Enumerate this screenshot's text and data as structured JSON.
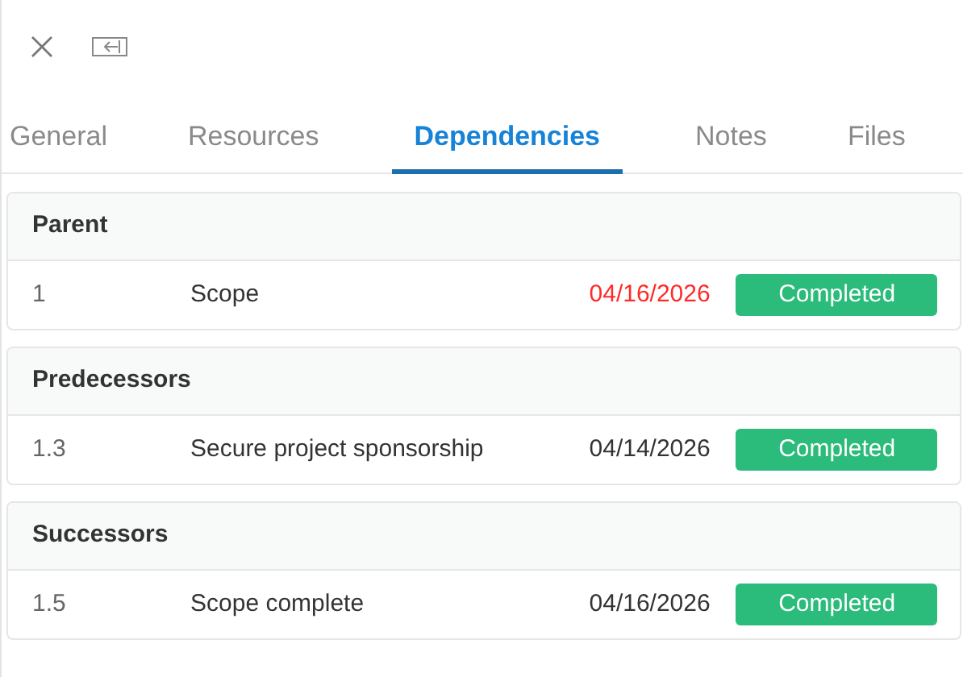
{
  "tabs": [
    {
      "label": "General",
      "selected": false
    },
    {
      "label": "Resources",
      "selected": false
    },
    {
      "label": "Dependencies",
      "selected": true
    },
    {
      "label": "Notes",
      "selected": false
    },
    {
      "label": "Files",
      "selected": false
    }
  ],
  "sections": [
    {
      "title": "Parent",
      "rows": [
        {
          "id": "1",
          "name": "Scope",
          "date": "04/16/2026",
          "overdue": true,
          "status": "Completed",
          "color": "#2bbb7a"
        }
      ]
    },
    {
      "title": "Predecessors",
      "rows": [
        {
          "id": "1.3",
          "name": "Secure project sponsorship",
          "date": "04/14/2026",
          "overdue": false,
          "status": "Completed",
          "color": "#2bbb7a"
        }
      ]
    },
    {
      "title": "Successors",
      "rows": [
        {
          "id": "1.5",
          "name": "Scope complete",
          "date": "04/16/2026",
          "overdue": false,
          "status": "Completed",
          "color": "#2bbb7a"
        }
      ]
    }
  ]
}
